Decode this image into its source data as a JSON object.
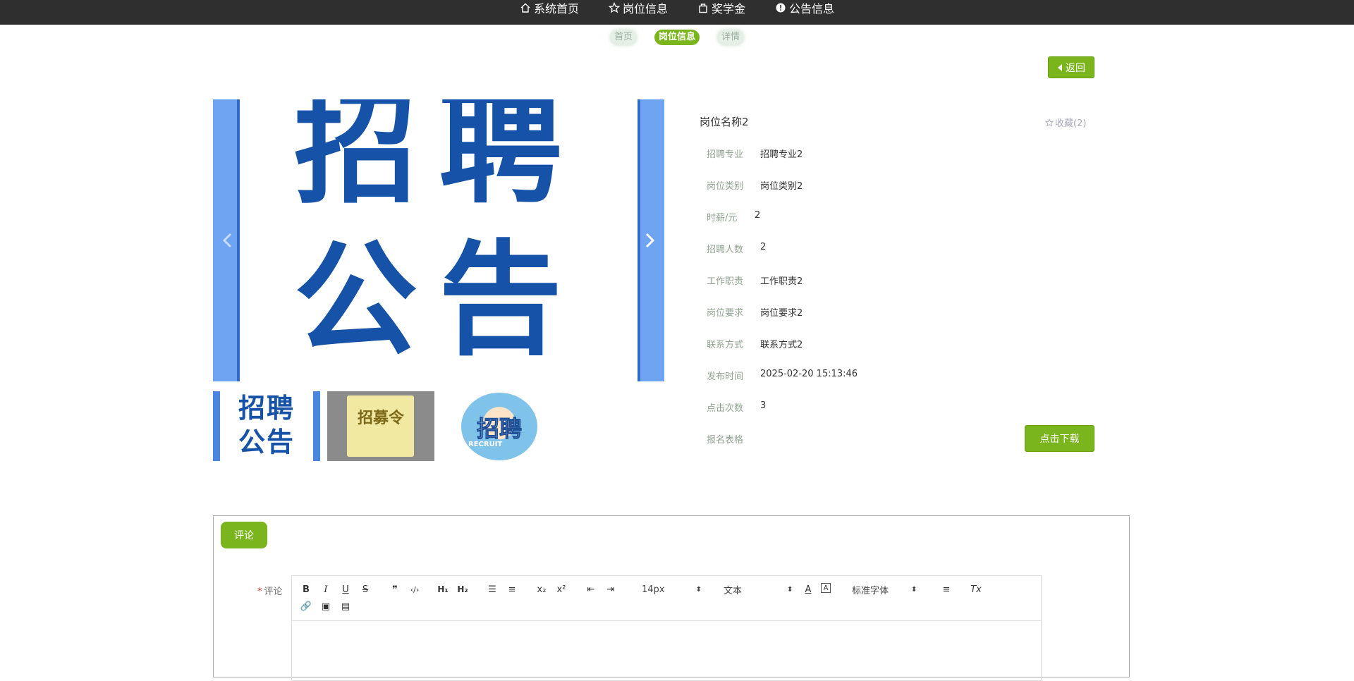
{
  "nav": [
    {
      "label": "系统首页",
      "icon": "home-icon"
    },
    {
      "label": "岗位信息",
      "icon": "star-icon"
    },
    {
      "label": "奖学金",
      "icon": "bag-icon"
    },
    {
      "label": "公告信息",
      "icon": "info-icon"
    }
  ],
  "breadcrumb": [
    "首页",
    "岗位信息",
    "详情"
  ],
  "back_label": "返回",
  "gallery": {
    "main_line1": "招聘",
    "main_line2": "公告",
    "thumbs": [
      {
        "line1": "招聘",
        "line2": "公告"
      },
      {
        "text": "招募令"
      },
      {
        "text": "招聘",
        "sub": "RECRUIT"
      }
    ]
  },
  "detail": {
    "title": "岗位名称2",
    "favorite": "收藏(2)",
    "fields": [
      {
        "label": "招聘专业",
        "value": "招聘专业2"
      },
      {
        "label": "岗位类别",
        "value": "岗位类别2"
      },
      {
        "label": "时薪/元",
        "value": "2"
      },
      {
        "label": "招聘人数",
        "value": "2"
      },
      {
        "label": "工作职责",
        "value": "工作职责2"
      },
      {
        "label": "岗位要求",
        "value": "岗位要求2"
      },
      {
        "label": "联系方式",
        "value": "联系方式2"
      },
      {
        "label": "发布时间",
        "value": "2025-02-20 15:13:46"
      },
      {
        "label": "点击次数",
        "value": "3"
      },
      {
        "label": "报名表格",
        "value": ""
      }
    ],
    "download_label": "点击下载"
  },
  "comment": {
    "tab_label": "评论",
    "field_label": "评论",
    "required_mark": "*",
    "toolbar": {
      "size": "14px",
      "format": "文本",
      "font": "标准字体"
    }
  }
}
